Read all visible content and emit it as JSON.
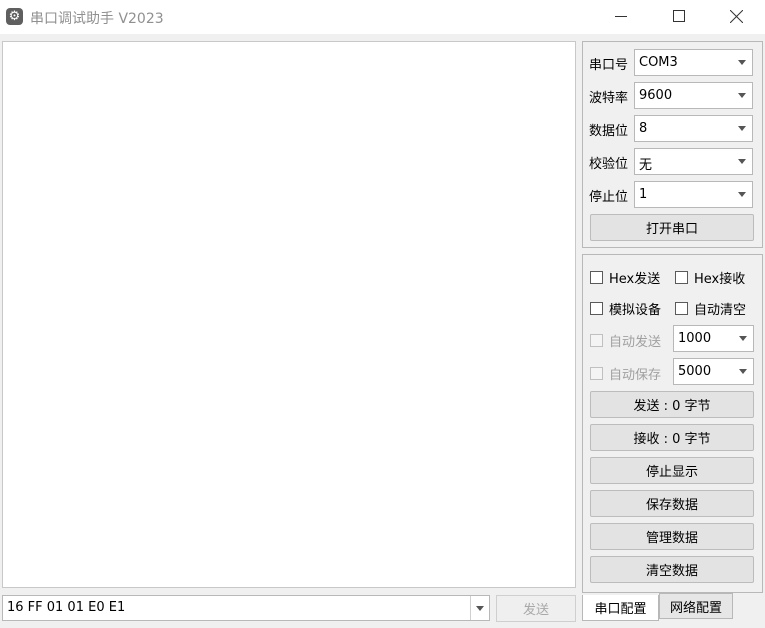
{
  "window": {
    "title": "串口调试助手 V2023",
    "app_icon": "gear-icon",
    "controls": [
      "minimize-icon",
      "maximize-icon",
      "close-icon"
    ]
  },
  "send": {
    "input_value": "16 FF 01 01 E0 E1",
    "button_label": "发送"
  },
  "serial_settings": {
    "port": {
      "label": "串口号",
      "value": "COM3"
    },
    "baud": {
      "label": "波特率",
      "value": "9600"
    },
    "data_bits": {
      "label": "数据位",
      "value": "8"
    },
    "parity": {
      "label": "校验位",
      "value": "无"
    },
    "stop_bits": {
      "label": "停止位",
      "value": "1"
    },
    "open_button": "打开串口"
  },
  "options": {
    "hex_send": "Hex发送",
    "hex_receive": "Hex接收",
    "simulate_device": "模拟设备",
    "auto_clear": "自动清空",
    "auto_send": "自动发送",
    "auto_send_interval": "1000",
    "auto_save": "自动保存",
    "auto_save_interval": "5000",
    "sent_count": "发送 : 0 字节",
    "received_count": "接收 : 0 字节",
    "stop_display": "停止显示",
    "save_data": "保存数据",
    "manage_data": "管理数据",
    "clear_data": "清空数据"
  },
  "tabs": {
    "serial_config": "串口配置",
    "network_config": "网络配置"
  }
}
